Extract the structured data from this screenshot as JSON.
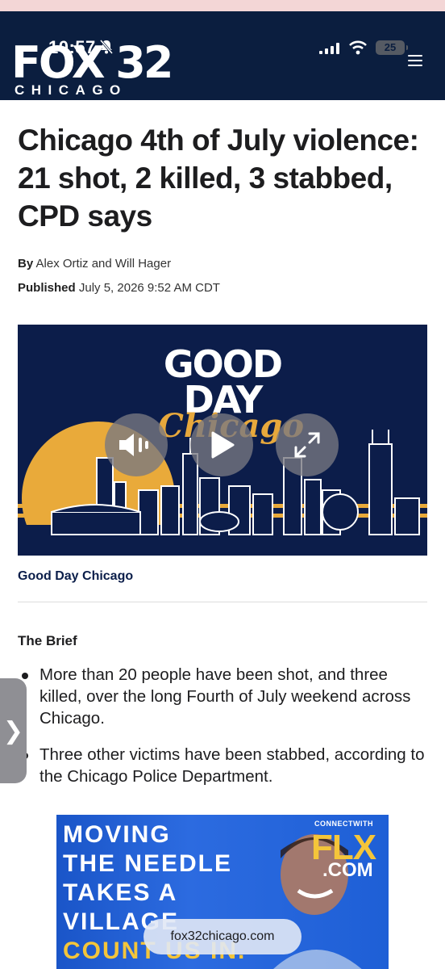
{
  "status": {
    "time": "10:57",
    "battery": "25"
  },
  "site": {
    "logo_main": "FOX 32",
    "logo_city": "CHICAGO"
  },
  "article": {
    "headline": "Chicago 4th of July violence: 21 shot, 2 killed, 3 stabbed, CPD says",
    "by_label": "By",
    "authors": "Alex Ortiz and Will Hager",
    "published_label": "Published",
    "published_date": "July 5, 2026 9:52 AM CDT"
  },
  "video": {
    "title_line1": "GOOD",
    "title_line2": "DAY",
    "title_script": "Chicago",
    "caption": "Good Day Chicago"
  },
  "brief": {
    "heading": "The Brief",
    "items": [
      "More than 20 people have been shot, and three killed, over the long Fourth of July weekend across Chicago.",
      "Three other victims have been stabbed, according to the Chicago Police Department."
    ]
  },
  "ad": {
    "line1": "MOVING",
    "line2": "THE NEEDLE",
    "line3": "TAKES A",
    "line4": "VILLAGE",
    "line5": "COUNT US IN.",
    "connect": "CONNECTWITH",
    "brand": "FLX",
    "brand_suffix": ".COM"
  },
  "browser": {
    "url": "fox32chicago.com"
  },
  "colors": {
    "header_bg": "#0b1e3f",
    "video_bg": "#0c1d4a",
    "accent_gold": "#e7a83c",
    "ad_blue": "#2c6be0"
  }
}
